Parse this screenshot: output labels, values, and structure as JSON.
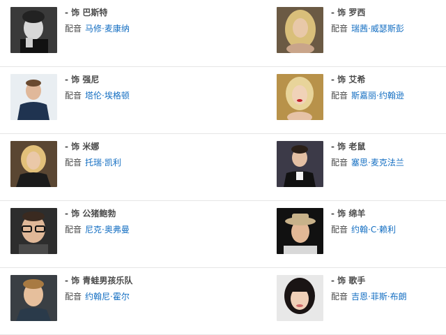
{
  "role_prefix": "- 饰",
  "voice_label": "配音",
  "cast": [
    {
      "role": "巴斯特",
      "voice_actor": "马修·麦康纳"
    },
    {
      "role": "罗西",
      "voice_actor": "瑞茜·威瑟斯彭"
    },
    {
      "role": "强尼",
      "voice_actor": "塔伦·埃格顿"
    },
    {
      "role": "艾希",
      "voice_actor": "斯嘉丽·约翰逊"
    },
    {
      "role": "米娜",
      "voice_actor": "托瑞·凯利"
    },
    {
      "role": "老鼠",
      "voice_actor": "塞思·麦克法兰"
    },
    {
      "role": "公猪鲍勃",
      "voice_actor": "尼克·奥弗曼"
    },
    {
      "role": "绵羊",
      "voice_actor": "约翰·C·赖利"
    },
    {
      "role": "青蛙男孩乐队",
      "voice_actor": "约翰尼·霍尔"
    },
    {
      "role": "歌手",
      "voice_actor": "吉恩·菲斯·布朗"
    }
  ],
  "colors": {
    "link": "#136ec2",
    "separator": "#e6e6e6"
  }
}
